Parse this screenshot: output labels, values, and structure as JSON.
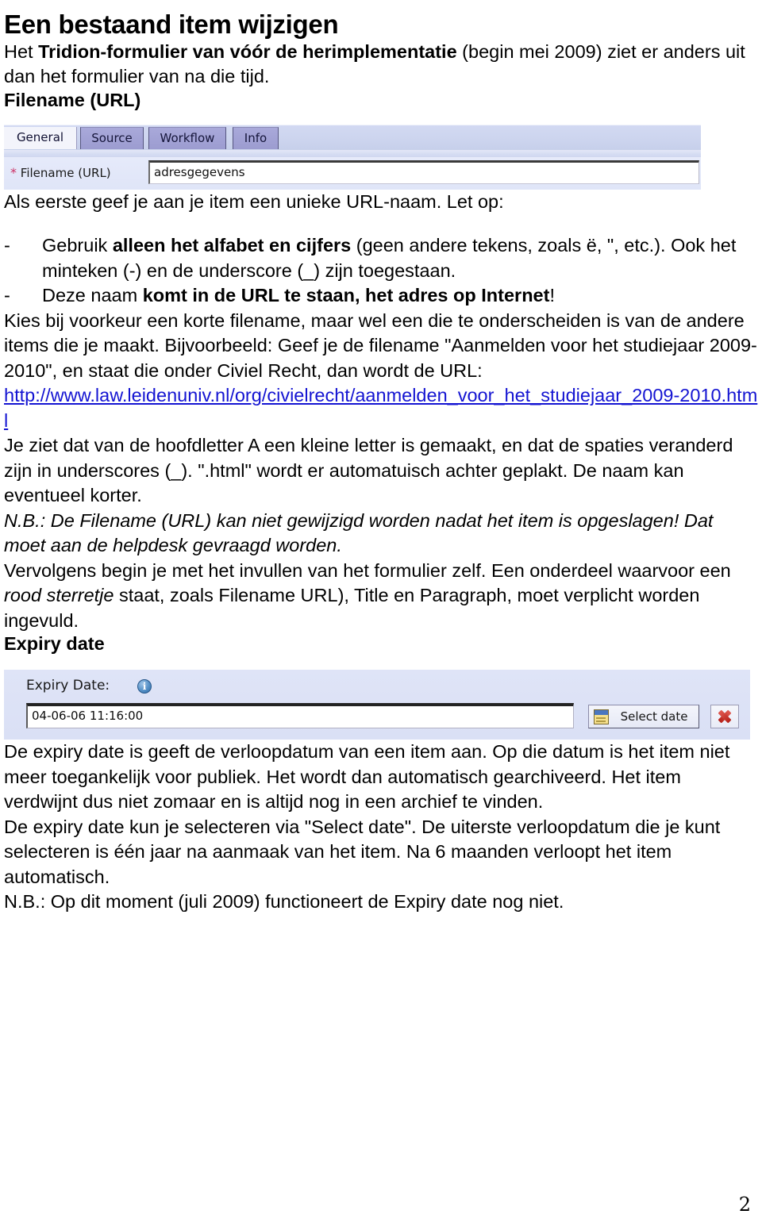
{
  "document": {
    "title": "Een bestaand item wijzigen",
    "page_number": "2"
  },
  "intro": {
    "before_bold": "Het ",
    "bold": "Tridion-formulier van vóór de herimplementatie",
    "after_bold": " (begin mei 2009) ziet er anders uit dan het formulier van na die tijd."
  },
  "sections": {
    "filename_heading": "Filename (URL)",
    "expiry_heading": "Expiry date"
  },
  "filename_form": {
    "tabs": [
      {
        "label": "General",
        "active": true
      },
      {
        "label": "Source",
        "active": false
      },
      {
        "label": "Workflow",
        "active": false
      },
      {
        "label": "Info",
        "active": false
      }
    ],
    "required_marker": "*",
    "field_label": "Filename (URL)",
    "field_value": "adresgegevens"
  },
  "expiry_form": {
    "label": "Expiry Date:",
    "info_icon_glyph": "i",
    "value": "04-06-06 11:16:00",
    "select_date_label": "Select date",
    "clear_tooltip": "Clear"
  },
  "paragraphs": {
    "unique_url": "Als eerste geef je aan je item een unieke URL-naam. Let op:",
    "bullets": [
      {
        "marker": "-",
        "part1": "Gebruik ",
        "bold": "alleen het alfabet en cijfers",
        "part2": " (geen andere tekens, zoals ë, \", etc.). Ook het minteken (-) en de underscore (_) zijn toegestaan."
      },
      {
        "marker": "-",
        "part1": "Deze naam ",
        "bold": "komt in de URL te staan, het adres op Internet",
        "part2": "!"
      }
    ],
    "korte_filename": "Kies bij voorkeur een korte filename, maar wel een die te onderscheiden is van de andere items die je maakt. Bijvoorbeeld: Geef je de filename \"Aanmelden voor het studiejaar 2009-2010\", en staat die onder Civiel Recht, dan wordt de URL:",
    "example_url": "http://www.law.leidenuniv.nl/org/civielrecht/aanmelden_voor_het_studiejaar_2009-2010.html",
    "after_url": "Je ziet dat van de hoofdletter A een kleine letter is gemaakt, en dat de spaties veranderd zijn in underscores (_). \".html\" wordt er automatuisch achter geplakt. De naam kan eventueel korter.",
    "nb_filename": "N.B.: De Filename (URL) kan niet gewijzigd worden nadat het item is opgeslagen! Dat moet aan de helpdesk gevraagd worden.",
    "vervolgens_p1": "Vervolgens begin je met het invullen van het formulier zelf. Een onderdeel waarvoor een ",
    "vervolgens_italic": "rood sterretje",
    "vervolgens_p2": " staat, zoals Filename URL), Title en Paragraph, moet verplicht worden ingevuld.",
    "expiry_explain": "De expiry date is geeft de verloopdatum van een item aan. Op die datum is het item niet meer toegankelijk voor publiek. Het wordt dan automatisch gearchiveerd. Het item verdwijnt dus niet zomaar en is altijd nog in een archief te vinden.",
    "expiry_select": "De expiry date kun je selecteren via \"Select date\". De uiterste verloopdatum die je kunt selecteren is één jaar na aanmaak van het item. Na 6 maanden verloopt het item automatisch.",
    "nb_expiry": "N.B.: Op dit moment (juli 2009) functioneert de Expiry date nog niet."
  }
}
